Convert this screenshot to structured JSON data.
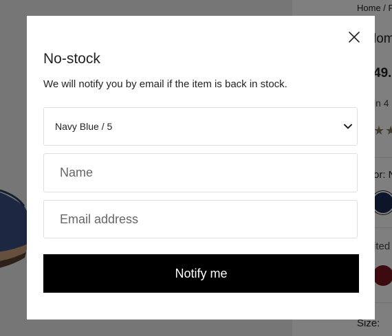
{
  "background": {
    "breadcrumb": "Home / P",
    "product_title_fragment": "lom",
    "price_fragment": "49.",
    "stock_fragment": "in 4",
    "rating_stars": "★★",
    "color_label_fragment": "or: N",
    "width_label_fragment": "ited",
    "size_label": "Size:"
  },
  "modal": {
    "title": "No-stock",
    "description": "We will notify you by email if the item is back in stock.",
    "variant_select": {
      "value": "Navy Blue / 5"
    },
    "name_field": {
      "placeholder": "Name",
      "value": ""
    },
    "email_field": {
      "placeholder": "Email address",
      "value": ""
    },
    "notify_button_label": "Notify me"
  },
  "colors": {
    "overlay": "rgba(0,0,0,0.5)",
    "button_bg": "#000000",
    "button_text": "#ffffff",
    "swatch_navy": "#1b2a54",
    "swatch_red": "#7a1420"
  },
  "icons": {
    "close": "close-icon",
    "select": "chevron-down-icon"
  }
}
